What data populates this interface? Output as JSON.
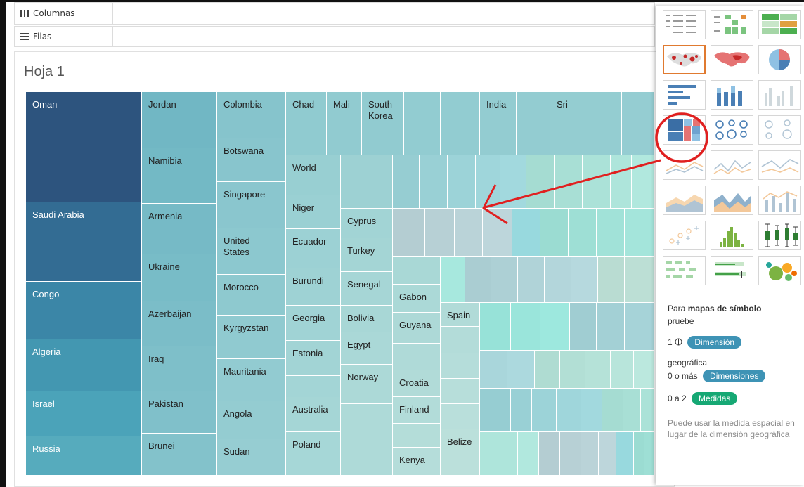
{
  "shelves": {
    "columns_label": "Columnas",
    "rows_label": "Filas"
  },
  "sheet": {
    "title": "Hoja 1"
  },
  "treemap_labels": {
    "oman": "Oman",
    "saudi": "Saudi Arabia",
    "congo": "Congo",
    "algeria": "Algeria",
    "israel": "Israel",
    "russia": "Russia",
    "jordan": "Jordan",
    "namibia": "Namibia",
    "armenia": "Armenia",
    "ukraine": "Ukraine",
    "azerbaijan": "Azerbaijan",
    "iraq": "Iraq",
    "pakistan": "Pakistan",
    "brunei": "Brunei",
    "colombia": "Colombia",
    "botswana": "Botswana",
    "singapore": "Singapore",
    "us": "United\nStates",
    "morocco": "Morocco",
    "kyrgyzstan": "Kyrgyzstan",
    "mauritania": "Mauritania",
    "angola": "Angola",
    "sudan": "Sudan",
    "chad": "Chad",
    "mali": "Mali",
    "skorea": "South\nKorea",
    "india": "India",
    "sri": "Sri",
    "world": "World",
    "niger": "Niger",
    "ecuador": "Ecuador",
    "burundi": "Burundi",
    "georgia": "Georgia",
    "estonia": "Estonia",
    "australia": "Australia",
    "poland": "Poland",
    "cyprus": "Cyprus",
    "turkey": "Turkey",
    "senegal": "Senegal",
    "bolivia": "Bolivia",
    "egypt": "Egypt",
    "norway": "Norway",
    "gabon": "Gabon",
    "guyana": "Guyana",
    "croatia": "Croatia",
    "finland": "Finland",
    "kenya": "Kenya",
    "spain": "Spain",
    "belize": "Belize"
  },
  "show_me": {
    "hint_prefix": "Para",
    "hint_bold": "mapas de símbolo",
    "hint_try": "pruebe",
    "req1_count": "1",
    "req1_pill": "Dimensión",
    "req1_suffix": "geográfica",
    "req2_count": "0 o más",
    "req2_pill": "Dimensiones",
    "req3_count": "0 a 2",
    "req3_pill": "Medidas",
    "note": "Puede usar la medida espacial en lugar de la dimensión geográfica"
  },
  "colors": {
    "dimension_pill": "#3e93b5",
    "measure_pill": "#16a874",
    "selected_border": "#e07a30",
    "annotation": "#e02020"
  }
}
